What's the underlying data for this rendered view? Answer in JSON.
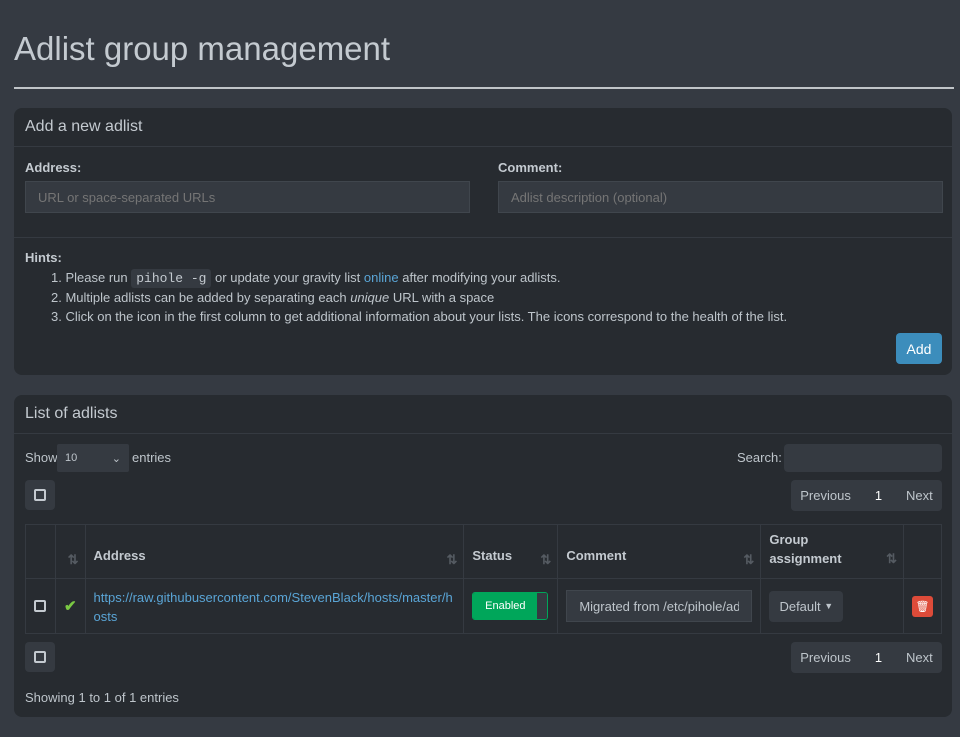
{
  "page": {
    "title": "Adlist group management"
  },
  "add_box": {
    "title": "Add a new adlist",
    "address_label": "Address:",
    "address_placeholder": "URL or space-separated URLs",
    "comment_label": "Comment:",
    "comment_placeholder": "Adlist description (optional)",
    "hints_label": "Hints:",
    "hint1_pre": "1. Please run ",
    "hint1_code": "pihole -g",
    "hint1_mid": " or update your gravity list ",
    "hint1_link": "online",
    "hint1_post": " after modifying your adlists.",
    "hint2_pre": "2. Multiple adlists can be added by separating each ",
    "hint2_em": "unique",
    "hint2_post": " URL with a space",
    "hint3": "3. Click on the icon in the first column to get additional information about your lists. The icons correspond to the health of the list.",
    "add_button": "Add",
    "accent": "#3c8dbc"
  },
  "list_box": {
    "title": "List of adlists",
    "show_label": "Show",
    "entries_value": "10",
    "entries_label": "entries",
    "search_label": "Search:",
    "pagination": {
      "previous": "Previous",
      "page": "1",
      "next": "Next"
    },
    "columns": [
      "",
      "",
      "Address",
      "Status",
      "Comment",
      "Group assignment",
      ""
    ],
    "rows": [
      {
        "address": "https://raw.githubusercontent.com/StevenBlack/hosts/master/hosts",
        "health_icon": "check-icon",
        "status": "Enabled",
        "comment": "Migrated from /etc/pihole/adlists.list",
        "group": "Default"
      }
    ],
    "footer": "Showing 1 to 1 of 1 entries",
    "status_color": "#00a65a",
    "delete_color": "#dd4b39"
  }
}
